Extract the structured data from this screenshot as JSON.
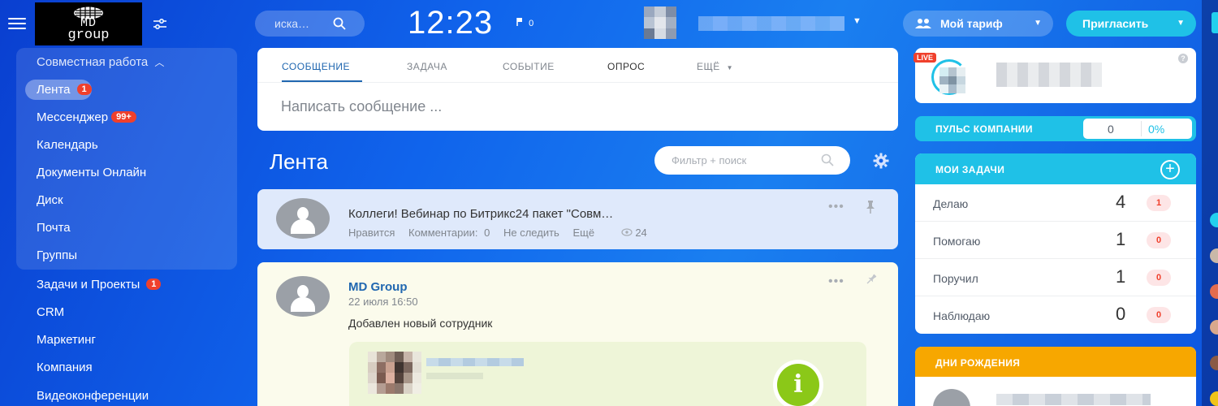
{
  "header": {
    "logo_line1": "MD",
    "logo_line2": "group",
    "search_placeholder": "иска…",
    "clock": "12:23",
    "flag_count": "0",
    "plan_button": "Мой тариф",
    "invite_button": "Пригласить"
  },
  "sidebar": {
    "group_title": "Совместная работа",
    "items": [
      {
        "label": "Лента",
        "badge": "1",
        "active": true
      },
      {
        "label": "Мессенджер",
        "badge": "99+"
      },
      {
        "label": "Календарь"
      },
      {
        "label": "Документы Онлайн"
      },
      {
        "label": "Диск"
      },
      {
        "label": "Почта"
      },
      {
        "label": "Группы"
      },
      {
        "label": "Задачи и Проекты",
        "badge": "1"
      },
      {
        "label": "CRM"
      },
      {
        "label": "Маркетинг"
      },
      {
        "label": "Компания"
      },
      {
        "label": "Видеоконференции"
      }
    ]
  },
  "composer": {
    "tabs": [
      "СООБЩЕНИЕ",
      "ЗАДАЧА",
      "СОБЫТИЕ",
      "ОПРОС",
      "ЕЩЁ"
    ],
    "active_tab": "СООБЩЕНИЕ",
    "placeholder": "Написать сообщение ..."
  },
  "feed": {
    "title": "Лента",
    "filter_placeholder": "Фильтр + поиск",
    "posts": [
      {
        "text": "Коллеги! Вебинар по Битрикс24 пакет \"Совм…",
        "actions": [
          "Нравится",
          "Комментарии:",
          "0",
          "Не следить",
          "Ещё"
        ],
        "views": "24"
      },
      {
        "author": "MD Group",
        "date": "22 июля 16:50",
        "body": "Добавлен новый сотрудник"
      }
    ]
  },
  "right": {
    "live_badge": "LIVE",
    "pulse": {
      "label": "ПУЛЬС КОМПАНИИ",
      "value": "0",
      "percent": "0%"
    },
    "tasks": {
      "title": "МОИ ЗАДАЧИ",
      "rows": [
        {
          "label": "Делаю",
          "count": "4",
          "badge": "1"
        },
        {
          "label": "Помогаю",
          "count": "1",
          "badge": "0"
        },
        {
          "label": "Поручил",
          "count": "1",
          "badge": "0"
        },
        {
          "label": "Наблюдаю",
          "count": "0",
          "badge": "0"
        }
      ]
    },
    "birthdays": {
      "title": "ДНИ РОЖДЕНИЯ"
    }
  },
  "colors": {
    "accent": "#1fc1e7",
    "badge_red": "#f0402c",
    "link": "#2067b0",
    "birthday": "#f7a700"
  }
}
